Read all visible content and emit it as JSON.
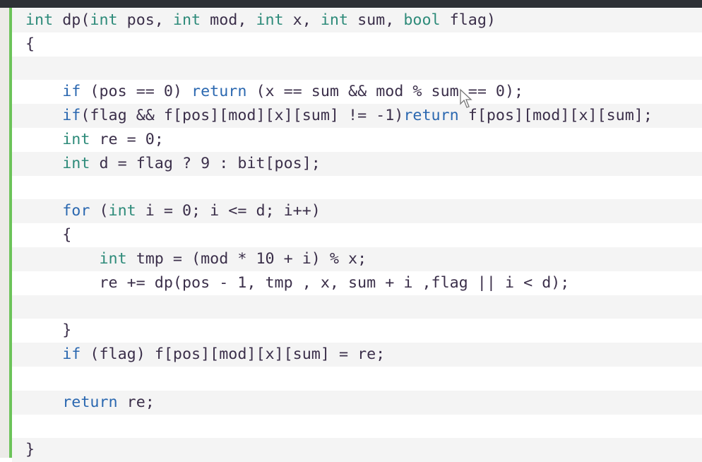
{
  "editor": {
    "accent_color": "#6cc35a",
    "colors": {
      "type": "#2e8b7a",
      "keyword": "#2b68b0",
      "identifier": "#3b2f4a"
    },
    "lines": [
      [
        [
          "type",
          "int"
        ],
        [
          "id",
          " dp("
        ],
        [
          "type",
          "int"
        ],
        [
          "id",
          " pos, "
        ],
        [
          "type",
          "int"
        ],
        [
          "id",
          " mod, "
        ],
        [
          "type",
          "int"
        ],
        [
          "id",
          " x, "
        ],
        [
          "type",
          "int"
        ],
        [
          "id",
          " sum, "
        ],
        [
          "type",
          "bool"
        ],
        [
          "id",
          " flag)"
        ]
      ],
      [
        [
          "id",
          "{"
        ]
      ],
      [],
      [
        [
          "id",
          "    "
        ],
        [
          "kw",
          "if"
        ],
        [
          "id",
          " (pos == 0) "
        ],
        [
          "kw",
          "return"
        ],
        [
          "id",
          " (x == sum && mod % sum == 0);"
        ]
      ],
      [
        [
          "id",
          "    "
        ],
        [
          "kw",
          "if"
        ],
        [
          "id",
          "(flag && f[pos][mod][x][sum] != -1)"
        ],
        [
          "kw",
          "return"
        ],
        [
          "id",
          " f[pos][mod][x][sum];"
        ]
      ],
      [
        [
          "id",
          "    "
        ],
        [
          "type",
          "int"
        ],
        [
          "id",
          " re = 0;"
        ]
      ],
      [
        [
          "id",
          "    "
        ],
        [
          "type",
          "int"
        ],
        [
          "id",
          " d = flag ? 9 : bit[pos];"
        ]
      ],
      [],
      [
        [
          "id",
          "    "
        ],
        [
          "kw",
          "for"
        ],
        [
          "id",
          " ("
        ],
        [
          "type",
          "int"
        ],
        [
          "id",
          " i = 0; i <= d; i++)"
        ]
      ],
      [
        [
          "id",
          "    {"
        ]
      ],
      [
        [
          "id",
          "        "
        ],
        [
          "type",
          "int"
        ],
        [
          "id",
          " tmp = (mod * 10 + i) % x;"
        ]
      ],
      [
        [
          "id",
          "        re += dp(pos - 1, tmp , x, sum + i ,flag || i < d);"
        ]
      ],
      [],
      [
        [
          "id",
          "    }"
        ]
      ],
      [
        [
          "id",
          "    "
        ],
        [
          "kw",
          "if"
        ],
        [
          "id",
          " (flag) f[pos][mod][x][sum] = re;"
        ]
      ],
      [],
      [
        [
          "id",
          "    "
        ],
        [
          "kw",
          "return"
        ],
        [
          "id",
          " re;"
        ]
      ],
      [],
      [
        [
          "id",
          "}"
        ]
      ]
    ]
  }
}
